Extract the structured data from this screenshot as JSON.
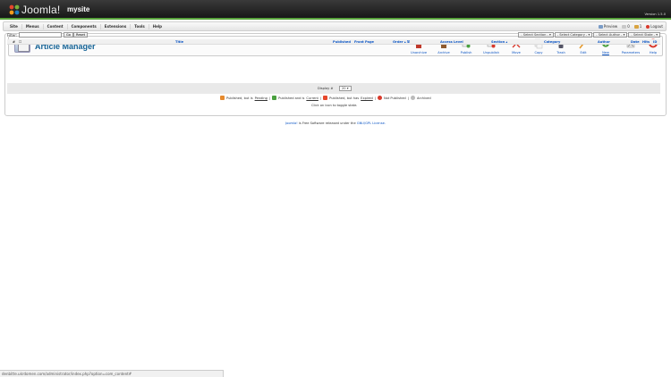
{
  "header": {
    "logo_text": "Joomla!",
    "site_name": "mysite",
    "version": "Version 1.5.0"
  },
  "menu": [
    "Site",
    "Menus",
    "Content",
    "Components",
    "Extensions",
    "Tools",
    "Help"
  ],
  "status": {
    "preview": "Preview",
    "messages": "0",
    "users": "1",
    "logout": "Logout"
  },
  "page_title": "Article Manager",
  "toolbar": [
    "Unarchive",
    "Archive",
    "Publish",
    "Unpublish",
    "Move",
    "Copy",
    "Trash",
    "Edit",
    "New",
    "Parameters",
    "Help"
  ],
  "filter": {
    "label": "Filter:",
    "value": "",
    "go": "Go",
    "reset": "Reset"
  },
  "selects": [
    "- Select Section -",
    "- Select Category -",
    "- Select Author -",
    "- Select State -"
  ],
  "columns": {
    "num": "#",
    "title": "Title",
    "published": "Published",
    "front_page": "Front Page",
    "order": "Order",
    "access": "Access Level",
    "section": "Section",
    "category": "Category",
    "author": "Author",
    "date": "Date",
    "hits": "Hits",
    "id": "ID"
  },
  "display": {
    "label": "Display #",
    "value": "20"
  },
  "legend": {
    "pending_text": "Published, but is",
    "pending_link": "Pending",
    "current_text": "Published and is",
    "current_link": "Current",
    "expired_text": "Published, but has",
    "expired_link": "Expired",
    "not_published": "Not Published",
    "archived": "Archived",
    "toggle_note": "Click on icon to toggle state."
  },
  "footer": {
    "joomla_link": "Joomla!",
    "middle": " is Free Software released under the ",
    "license_link": "GNU/GPL License."
  },
  "status_url": "denbitte.ukrdomen.com/administrator/index.php?option=com_content#",
  "colors": {
    "brand_green": "#58a33c",
    "link_blue": "#0b55c4",
    "title_blue": "#146295"
  }
}
